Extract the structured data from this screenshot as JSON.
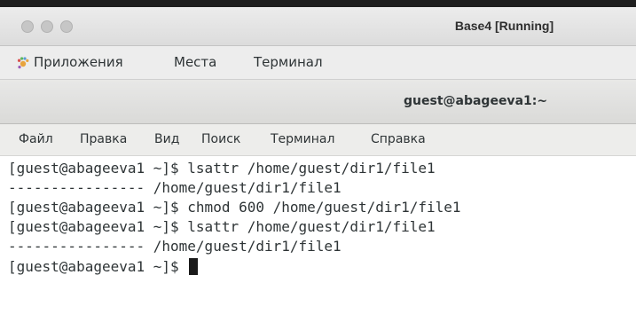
{
  "vm_window": {
    "title": "Base4 [Running]"
  },
  "gnome_panel": {
    "applications": "Приложения",
    "places": "Места",
    "terminal": "Терминал",
    "apps_icon": "gnome-foot-icon"
  },
  "terminal_window": {
    "title": "guest@abageeva1:~"
  },
  "terminal_menu": {
    "file": "Файл",
    "edit": "Правка",
    "view": "Вид",
    "search": "Поиск",
    "terminal": "Терминал",
    "help": "Справка"
  },
  "terminal_output": {
    "lines": [
      "[guest@abageeva1 ~]$ lsattr /home/guest/dir1/file1",
      "---------------- /home/guest/dir1/file1",
      "[guest@abageeva1 ~]$ chmod 600 /home/guest/dir1/file1",
      "[guest@abageeva1 ~]$ lsattr /home/guest/dir1/file1",
      "---------------- /home/guest/dir1/file1",
      "[guest@abageeva1 ~]$ "
    ]
  }
}
